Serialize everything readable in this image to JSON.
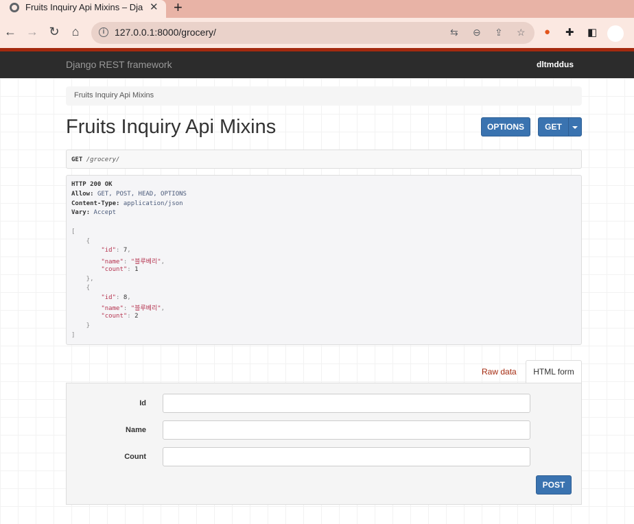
{
  "browser": {
    "tab_title": "Fruits Inquiry Api Mixins – Django REST framework",
    "url": "127.0.0.1:8000/grocery/",
    "accent_color": "#e8b3a6"
  },
  "navbar": {
    "brand": "Django REST framework",
    "user": "dltmddus"
  },
  "breadcrumb": "Fruits Inquiry Api Mixins",
  "page_title": "Fruits Inquiry Api Mixins",
  "buttons": {
    "options": "OPTIONS",
    "get": "GET",
    "post": "POST"
  },
  "request": {
    "method": "GET",
    "path": "/grocery/"
  },
  "response": {
    "status": "HTTP 200 OK",
    "headers": [
      {
        "key": "Allow",
        "value": "GET, POST, HEAD, OPTIONS"
      },
      {
        "key": "Content-Type",
        "value": "application/json"
      },
      {
        "key": "Vary",
        "value": "Accept"
      }
    ],
    "items": [
      {
        "id": "7",
        "name": "블루베리",
        "count": "1"
      },
      {
        "id": "8",
        "name": "블루베리",
        "count": "2"
      }
    ]
  },
  "form_tabs": {
    "raw": "Raw data",
    "html": "HTML form"
  },
  "form": {
    "fields": [
      {
        "label": "Id",
        "value": ""
      },
      {
        "label": "Name",
        "value": ""
      },
      {
        "label": "Count",
        "value": ""
      }
    ]
  }
}
